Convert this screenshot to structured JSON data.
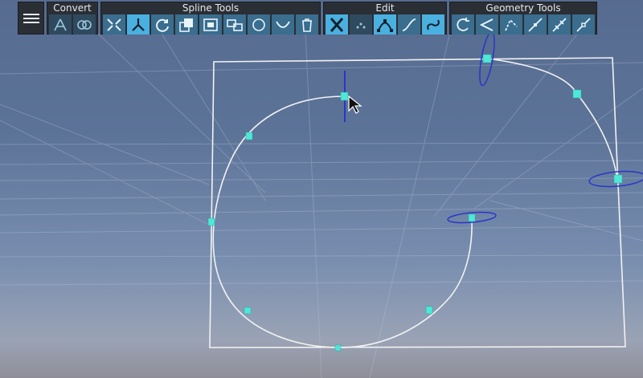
{
  "toolbar": {
    "menu_icon": "hamburger-icon",
    "groups": [
      {
        "title": "Convert",
        "buttons": [
          "convert-to-spline-icon",
          "convert-to-mesh-icon"
        ]
      },
      {
        "title": "Spline Tools",
        "buttons": [
          "merge-points-icon",
          "split-icon",
          "refresh-icon",
          "duplicate-icon",
          "frame-icon",
          "align-icon",
          "circle-icon",
          "arc-icon",
          "trash-icon"
        ]
      },
      {
        "title": "Edit",
        "buttons": [
          "delete-x-icon",
          "points-icon",
          "bezier-icon",
          "smooth-curve-icon",
          "loop-curve-icon"
        ]
      },
      {
        "title": "Geometry Tools",
        "buttons": [
          "rotate-icon",
          "angle-icon",
          "chamfer-icon",
          "line-pen-icon",
          "line-extend-icon",
          "line-cut-icon"
        ]
      }
    ]
  },
  "colors": {
    "toolbar_bg": "#2a2e35",
    "button_bg": "#3a6d8e",
    "button_active": "#4ab0e0",
    "control_point": "#4fe8d8",
    "spline": "#f2f2f2",
    "handle_ring": "#2a35c8"
  },
  "viewport": {
    "cursor_icon": "pointer-cursor-icon"
  }
}
